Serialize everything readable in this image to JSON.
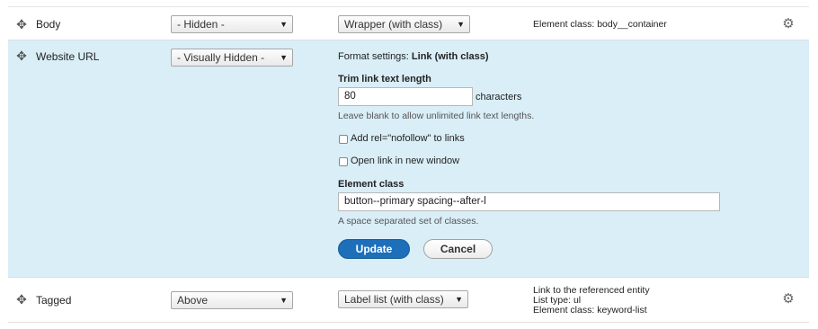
{
  "rows": {
    "body": {
      "field_name": "Body",
      "label_select": "- Hidden -",
      "format_select": "Wrapper (with class)",
      "summary": "Element class: body__container",
      "drag_icon": "move-handle-icon",
      "gear_icon": "gear-icon"
    },
    "website_url": {
      "field_name": "Website URL",
      "label_select": "- Visually Hidden -",
      "settings": {
        "heading_prefix": "Format settings: ",
        "heading_format": "Link (with class)",
        "trim_label": "Trim link text length",
        "trim_value": "80",
        "trim_suffix": "characters",
        "trim_description": "Leave blank to allow unlimited link text lengths.",
        "nofollow_label": "Add rel=\"nofollow\" to links",
        "nofollow_checked": false,
        "new_window_label": "Open link in new window",
        "new_window_checked": false,
        "element_class_label": "Element class",
        "element_class_value": "button--primary spacing--after-l",
        "element_class_description": "A space separated set of classes.",
        "update_label": "Update",
        "cancel_label": "Cancel"
      }
    },
    "tagged": {
      "field_name": "Tagged",
      "label_select": "Above",
      "format_select": "Label list (with class)",
      "summary_lines": [
        "Link to the referenced entity",
        "List type: ul",
        "Element class: keyword-list"
      ]
    }
  },
  "colors": {
    "active_row_bg": "#d9eef7",
    "primary_button": "#1e6fba"
  }
}
